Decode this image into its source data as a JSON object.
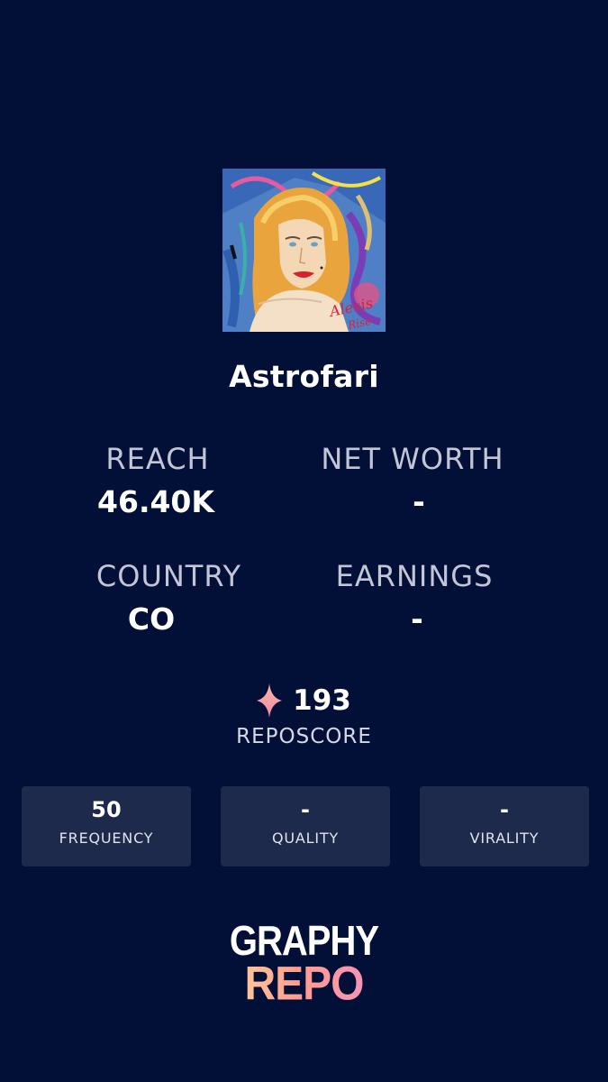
{
  "profile": {
    "name": "Astrofari",
    "avatar_signature": "Alexis Rise"
  },
  "stats": {
    "reach_label": "REACH",
    "reach_value": "46.40K",
    "net_worth_label": "NET WORTH",
    "net_worth_value": "-",
    "country_label": "COUNTRY",
    "country_value": "CO",
    "earnings_label": "EARNINGS",
    "earnings_value": "-"
  },
  "score": {
    "value": "193",
    "label": "REPOSCORE",
    "icon": "sparkle-icon"
  },
  "cards": [
    {
      "value": "50",
      "label": "FREQUENCY"
    },
    {
      "value": "-",
      "label": "QUALITY"
    },
    {
      "value": "-",
      "label": "VIRALITY"
    }
  ],
  "logo": {
    "line1": "GRAPHY",
    "line2": "REPO"
  },
  "colors": {
    "background": "#021038",
    "card": "#1d2a4c",
    "label": "#c2c6d6",
    "sparkle": "#f7a9a1"
  }
}
